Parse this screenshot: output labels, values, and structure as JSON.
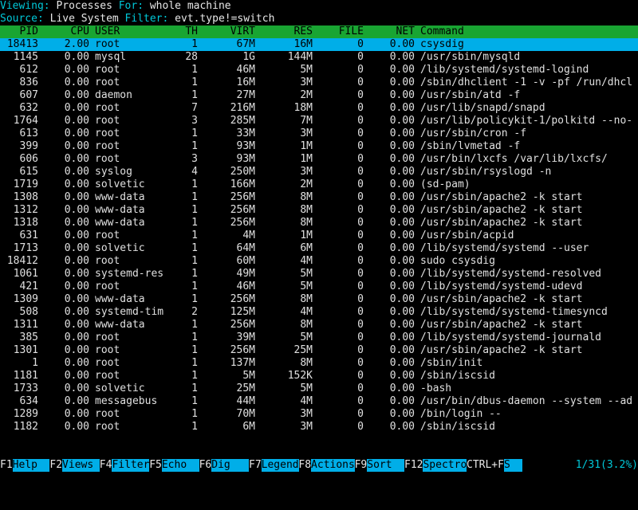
{
  "header": {
    "viewing_label": "Viewing:",
    "viewing_value": " Processes ",
    "for_label": "For:",
    "for_value": " whole machine",
    "source_label": "Source:",
    "source_value": " Live System ",
    "filter_label": "Filter:",
    "filter_value": " evt.type!=switch"
  },
  "columns": {
    "pid": "PID",
    "cpu": "CPU",
    "user": "USER",
    "th": "TH",
    "virt": "VIRT",
    "res": "RES",
    "file": "FILE",
    "net": "NET",
    "cmd": "Command"
  },
  "rows": [
    {
      "pid": "18413",
      "cpu": "2.00",
      "user": "root",
      "th": "1",
      "virt": "67M",
      "res": "16M",
      "file": "0",
      "net": "0.00",
      "cmd": "csysdig"
    },
    {
      "pid": "1145",
      "cpu": "0.00",
      "user": "mysql",
      "th": "28",
      "virt": "1G",
      "res": "144M",
      "file": "0",
      "net": "0.00",
      "cmd": "/usr/sbin/mysqld"
    },
    {
      "pid": "612",
      "cpu": "0.00",
      "user": "root",
      "th": "1",
      "virt": "46M",
      "res": "5M",
      "file": "0",
      "net": "0.00",
      "cmd": "/lib/systemd/systemd-logind"
    },
    {
      "pid": "836",
      "cpu": "0.00",
      "user": "root",
      "th": "1",
      "virt": "16M",
      "res": "3M",
      "file": "0",
      "net": "0.00",
      "cmd": "/sbin/dhclient -1 -v -pf /run/dhcl"
    },
    {
      "pid": "607",
      "cpu": "0.00",
      "user": "daemon",
      "th": "1",
      "virt": "27M",
      "res": "2M",
      "file": "0",
      "net": "0.00",
      "cmd": "/usr/sbin/atd -f"
    },
    {
      "pid": "632",
      "cpu": "0.00",
      "user": "root",
      "th": "7",
      "virt": "216M",
      "res": "18M",
      "file": "0",
      "net": "0.00",
      "cmd": "/usr/lib/snapd/snapd"
    },
    {
      "pid": "1764",
      "cpu": "0.00",
      "user": "root",
      "th": "3",
      "virt": "285M",
      "res": "7M",
      "file": "0",
      "net": "0.00",
      "cmd": "/usr/lib/policykit-1/polkitd --no-"
    },
    {
      "pid": "613",
      "cpu": "0.00",
      "user": "root",
      "th": "1",
      "virt": "33M",
      "res": "3M",
      "file": "0",
      "net": "0.00",
      "cmd": "/usr/sbin/cron -f"
    },
    {
      "pid": "399",
      "cpu": "0.00",
      "user": "root",
      "th": "1",
      "virt": "93M",
      "res": "1M",
      "file": "0",
      "net": "0.00",
      "cmd": "/sbin/lvmetad -f"
    },
    {
      "pid": "606",
      "cpu": "0.00",
      "user": "root",
      "th": "3",
      "virt": "93M",
      "res": "1M",
      "file": "0",
      "net": "0.00",
      "cmd": "/usr/bin/lxcfs /var/lib/lxcfs/"
    },
    {
      "pid": "615",
      "cpu": "0.00",
      "user": "syslog",
      "th": "4",
      "virt": "250M",
      "res": "3M",
      "file": "0",
      "net": "0.00",
      "cmd": "/usr/sbin/rsyslogd -n"
    },
    {
      "pid": "1719",
      "cpu": "0.00",
      "user": "solvetic",
      "th": "1",
      "virt": "166M",
      "res": "2M",
      "file": "0",
      "net": "0.00",
      "cmd": "(sd-pam)"
    },
    {
      "pid": "1308",
      "cpu": "0.00",
      "user": "www-data",
      "th": "1",
      "virt": "256M",
      "res": "8M",
      "file": "0",
      "net": "0.00",
      "cmd": "/usr/sbin/apache2 -k start"
    },
    {
      "pid": "1312",
      "cpu": "0.00",
      "user": "www-data",
      "th": "1",
      "virt": "256M",
      "res": "8M",
      "file": "0",
      "net": "0.00",
      "cmd": "/usr/sbin/apache2 -k start"
    },
    {
      "pid": "1318",
      "cpu": "0.00",
      "user": "www-data",
      "th": "1",
      "virt": "256M",
      "res": "8M",
      "file": "0",
      "net": "0.00",
      "cmd": "/usr/sbin/apache2 -k start"
    },
    {
      "pid": "631",
      "cpu": "0.00",
      "user": "root",
      "th": "1",
      "virt": "4M",
      "res": "1M",
      "file": "0",
      "net": "0.00",
      "cmd": "/usr/sbin/acpid"
    },
    {
      "pid": "1713",
      "cpu": "0.00",
      "user": "solvetic",
      "th": "1",
      "virt": "64M",
      "res": "6M",
      "file": "0",
      "net": "0.00",
      "cmd": "/lib/systemd/systemd --user"
    },
    {
      "pid": "18412",
      "cpu": "0.00",
      "user": "root",
      "th": "1",
      "virt": "60M",
      "res": "4M",
      "file": "0",
      "net": "0.00",
      "cmd": "sudo csysdig"
    },
    {
      "pid": "1061",
      "cpu": "0.00",
      "user": "systemd-res",
      "th": "1",
      "virt": "49M",
      "res": "5M",
      "file": "0",
      "net": "0.00",
      "cmd": "/lib/systemd/systemd-resolved"
    },
    {
      "pid": "421",
      "cpu": "0.00",
      "user": "root",
      "th": "1",
      "virt": "46M",
      "res": "5M",
      "file": "0",
      "net": "0.00",
      "cmd": "/lib/systemd/systemd-udevd"
    },
    {
      "pid": "1309",
      "cpu": "0.00",
      "user": "www-data",
      "th": "1",
      "virt": "256M",
      "res": "8M",
      "file": "0",
      "net": "0.00",
      "cmd": "/usr/sbin/apache2 -k start"
    },
    {
      "pid": "508",
      "cpu": "0.00",
      "user": "systemd-tim",
      "th": "2",
      "virt": "125M",
      "res": "4M",
      "file": "0",
      "net": "0.00",
      "cmd": "/lib/systemd/systemd-timesyncd"
    },
    {
      "pid": "1311",
      "cpu": "0.00",
      "user": "www-data",
      "th": "1",
      "virt": "256M",
      "res": "8M",
      "file": "0",
      "net": "0.00",
      "cmd": "/usr/sbin/apache2 -k start"
    },
    {
      "pid": "385",
      "cpu": "0.00",
      "user": "root",
      "th": "1",
      "virt": "39M",
      "res": "5M",
      "file": "0",
      "net": "0.00",
      "cmd": "/lib/systemd/systemd-journald"
    },
    {
      "pid": "1301",
      "cpu": "0.00",
      "user": "root",
      "th": "1",
      "virt": "256M",
      "res": "25M",
      "file": "0",
      "net": "0.00",
      "cmd": "/usr/sbin/apache2 -k start"
    },
    {
      "pid": "1",
      "cpu": "0.00",
      "user": "root",
      "th": "1",
      "virt": "137M",
      "res": "8M",
      "file": "0",
      "net": "0.00",
      "cmd": "/sbin/init"
    },
    {
      "pid": "1181",
      "cpu": "0.00",
      "user": "root",
      "th": "1",
      "virt": "5M",
      "res": "152K",
      "file": "0",
      "net": "0.00",
      "cmd": "/sbin/iscsid"
    },
    {
      "pid": "1733",
      "cpu": "0.00",
      "user": "solvetic",
      "th": "1",
      "virt": "25M",
      "res": "5M",
      "file": "0",
      "net": "0.00",
      "cmd": "-bash"
    },
    {
      "pid": "634",
      "cpu": "0.00",
      "user": "messagebus",
      "th": "1",
      "virt": "44M",
      "res": "4M",
      "file": "0",
      "net": "0.00",
      "cmd": "/usr/bin/dbus-daemon --system --ad"
    },
    {
      "pid": "1289",
      "cpu": "0.00",
      "user": "root",
      "th": "1",
      "virt": "70M",
      "res": "3M",
      "file": "0",
      "net": "0.00",
      "cmd": "/bin/login --"
    },
    {
      "pid": "1182",
      "cpu": "0.00",
      "user": "root",
      "th": "1",
      "virt": "6M",
      "res": "3M",
      "file": "0",
      "net": "0.00",
      "cmd": "/sbin/iscsid"
    }
  ],
  "footer": {
    "keys": [
      {
        "key": "F1",
        "label": "Help"
      },
      {
        "key": "F2",
        "label": "Views"
      },
      {
        "key": "F4",
        "label": "Filter"
      },
      {
        "key": "F5",
        "label": "Echo"
      },
      {
        "key": "F6",
        "label": "Dig"
      },
      {
        "key": "F7",
        "label": "Legend"
      },
      {
        "key": "F8",
        "label": "Actions"
      },
      {
        "key": "F9",
        "label": "Sort"
      },
      {
        "key": "F12",
        "label": "Spectro"
      },
      {
        "key": "CTRL+F",
        "label": "S"
      }
    ],
    "page": "1/31(3.2%)"
  },
  "colors": {
    "header_green": "#19a532",
    "selected_row": "#00aee8",
    "label_cyan": "#00c8d8"
  }
}
